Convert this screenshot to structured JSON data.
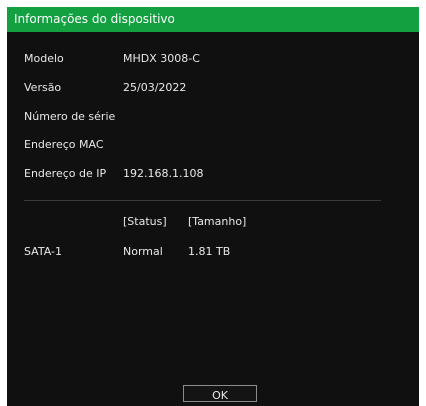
{
  "window": {
    "title": "Informações do dispositivo"
  },
  "info": [
    {
      "label": "Modelo",
      "value": "MHDX 3008-C"
    },
    {
      "label": "Versão",
      "value": "25/03/2022"
    },
    {
      "label": "Número de série",
      "value": ""
    },
    {
      "label": "Endereço MAC",
      "value": ""
    },
    {
      "label": "Endereço de IP",
      "value": "192.168.1.108"
    }
  ],
  "disks": {
    "headers": [
      "[Status]",
      "[Tamanho]"
    ],
    "rows": [
      {
        "name": "SATA-1",
        "status": "Normal",
        "size": "1.81 TB"
      }
    ]
  },
  "buttons": {
    "ok_label": "OK"
  },
  "colors": {
    "titlebar": "#13a040",
    "background": "#101010"
  }
}
